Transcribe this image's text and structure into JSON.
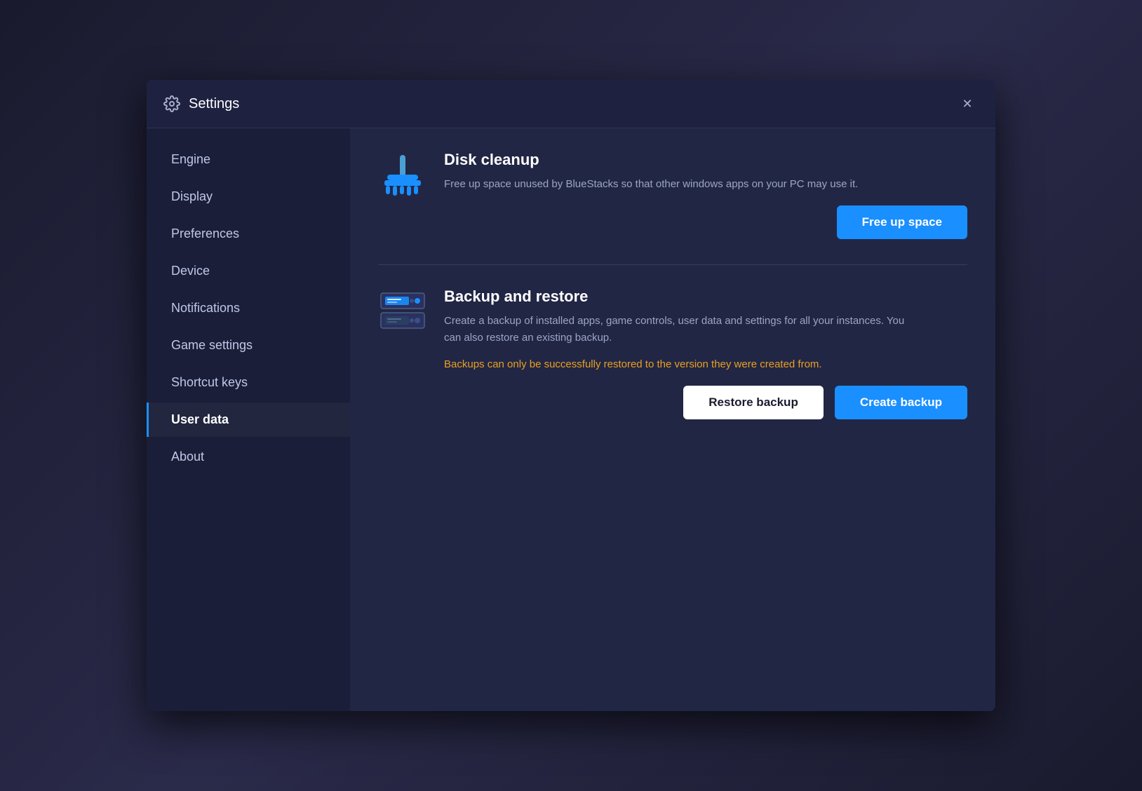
{
  "window": {
    "title": "Settings",
    "close_label": "✕"
  },
  "sidebar": {
    "items": [
      {
        "id": "engine",
        "label": "Engine",
        "active": false
      },
      {
        "id": "display",
        "label": "Display",
        "active": false
      },
      {
        "id": "preferences",
        "label": "Preferences",
        "active": false
      },
      {
        "id": "device",
        "label": "Device",
        "active": false
      },
      {
        "id": "notifications",
        "label": "Notifications",
        "active": false
      },
      {
        "id": "game-settings",
        "label": "Game settings",
        "active": false
      },
      {
        "id": "shortcut-keys",
        "label": "Shortcut keys",
        "active": false
      },
      {
        "id": "user-data",
        "label": "User data",
        "active": true
      },
      {
        "id": "about",
        "label": "About",
        "active": false
      }
    ]
  },
  "content": {
    "disk_cleanup": {
      "title": "Disk cleanup",
      "description": "Free up space unused by BlueStacks so that other windows apps on your PC may use it.",
      "button_label": "Free up space"
    },
    "backup_restore": {
      "title": "Backup and restore",
      "description": "Create a backup of installed apps, game controls, user data and settings for all your instances. You can also restore an existing backup.",
      "warning": "Backups can only be successfully restored to the version they were created from.",
      "restore_label": "Restore backup",
      "create_label": "Create backup"
    }
  }
}
